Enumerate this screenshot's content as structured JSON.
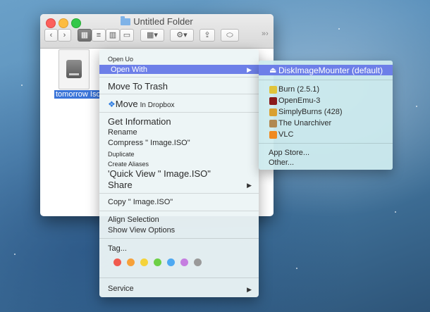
{
  "window": {
    "title": "Untitled Folder",
    "more": "»›"
  },
  "file": {
    "label": "tomorrow Iso"
  },
  "context_menu": {
    "open_small": "Open Uo",
    "open_with": "Open With",
    "move_to_trash": "Move To Trash",
    "move_dropbox_big": "Move",
    "move_dropbox_small": "In Dropbox",
    "get_information": "Get Information",
    "rename": "Rename",
    "compress": "Compress \" Image.ISO\"",
    "duplicate": "Duplicate",
    "create_aliases": "Create Aliases",
    "quick_view": "'Quick View \" Image.ISO\"",
    "share": "Share",
    "copy": "Copy \" Image.ISO\"",
    "align_selection": "Align Selection",
    "show_view_options": "Show View Options",
    "tag": "Tag...",
    "service": "Service",
    "tag_colors": [
      "#f05a4e",
      "#f7a13a",
      "#f5d33b",
      "#6dd046",
      "#4ea9f2",
      "#c57ee0",
      "#9a9a9a"
    ]
  },
  "open_with_menu": {
    "default_app": "DiskImageMounter (default)",
    "apps": [
      {
        "name": "Burn (2.5.1)",
        "color": "#e0c43a"
      },
      {
        "name": "OpenEmu-3",
        "color": "#8a1a1a"
      },
      {
        "name": "SimplyBurns (428)",
        "color": "#d9a030"
      },
      {
        "name": "The Unarchiver",
        "color": "#b08850"
      },
      {
        "name": "VLC",
        "color": "#f08a20"
      }
    ],
    "app_store": "App Store...",
    "other": "Other..."
  }
}
